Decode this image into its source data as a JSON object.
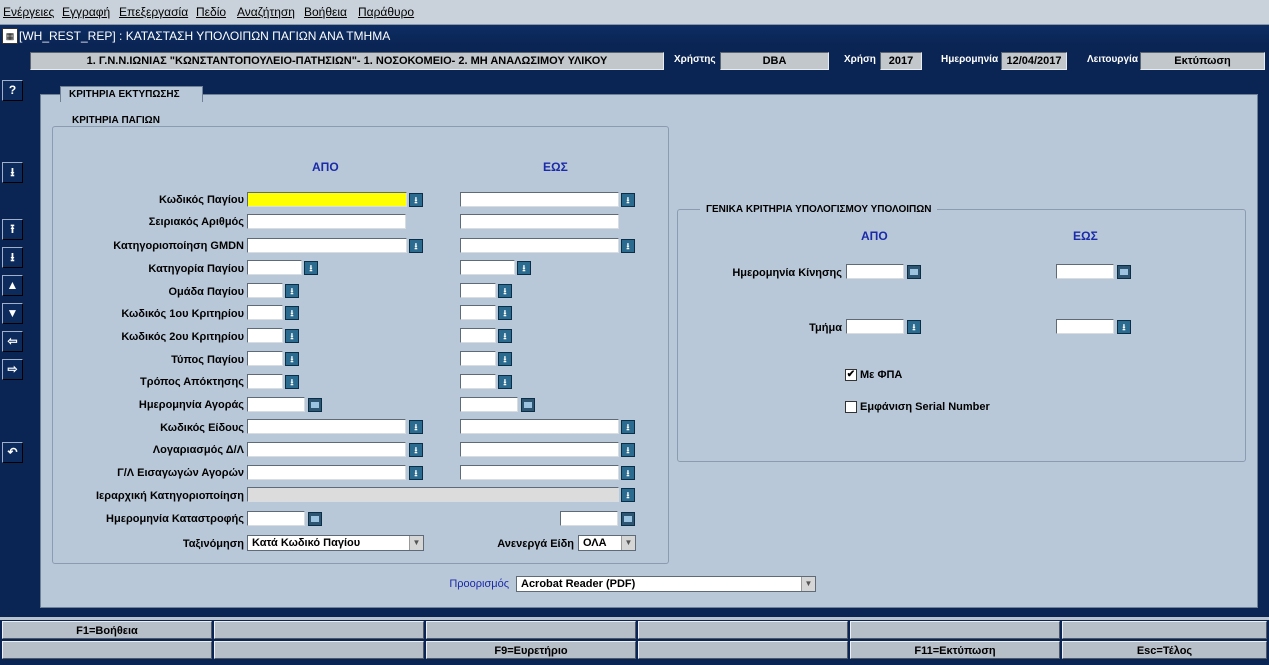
{
  "menu": [
    "Ενέργειες",
    "Εγγραφή",
    "Επεξεργασία",
    "Πεδίο",
    "Αναζήτηση",
    "Βοήθεια",
    "Παράθυρο"
  ],
  "window": {
    "title": "[WH_REST_REP]  :  ΚΑΤΑΣΤΑΣΗ ΥΠΟΛΟΙΠΩΝ ΠΑΓΙΩΝ ΑΝΑ ΤΜΗΜΑ"
  },
  "info": {
    "org": "1. Γ.Ν.Ν.ΙΩΝΙΑΣ \"ΚΩΝΣΤΑΝΤΟΠΟΥΛΕΙΟ-ΠΑΤΗΣΙΩΝ\"- 1. ΝΟΣΟΚΟΜΕΙΟ- 2. ΜΗ ΑΝΑΛΩΣΙΜΟΥ ΥΛΙΚΟΥ",
    "user_label": "Χρήστης",
    "user": "DBA",
    "year_label": "Χρήση",
    "year": "2017",
    "date_label": "Ημερομηνία",
    "date": "12/04/2017",
    "mode_label": "Λειτουργία",
    "mode": "Εκτύπωση"
  },
  "tab_label": "ΚΡΙΤΗΡΙΑ ΕΚΤΥΠΩΣΗΣ",
  "assets": {
    "title": "ΚΡΙΤΗΡΙΑ ΠΑΓΙΩΝ",
    "from": "ΑΠΟ",
    "to": "ΕΩΣ",
    "rows": [
      "Κωδικός Παγίου",
      "Σειριακός Αριθμός",
      "Κατηγοριοποίηση GMDN",
      "Κατηγορία Παγίου",
      "Ομάδα Παγίου",
      "Κωδικός 1ου Κριτηρίου",
      "Κωδικός 2ου Κριτηρίου",
      "Τύπος Παγίου",
      "Τρόπος Απόκτησης",
      "Ημερομηνία Αγοράς",
      "Κωδικός Είδους",
      "Λογαριασμός Δ/Λ",
      "Γ/Λ Εισαγωγών Αγορών",
      "Ιεραρχική Κατηγοριοποίηση",
      "Ημερομηνία Καταστροφής"
    ],
    "sort_label": "Ταξινόμηση",
    "sort_value": "Κατά Κωδικό Παγίου",
    "inactive_label": "Ανενεργά Είδη",
    "inactive_value": "ΟΛΑ"
  },
  "general": {
    "title": "ΓΕΝΙΚΑ ΚΡΙΤΗΡΙΑ ΥΠΟΛΟΓΙΣΜΟΥ ΥΠΟΛΟΙΠΩΝ",
    "from": "ΑΠΟ",
    "to": "ΕΩΣ",
    "move_date_label": "Ημερομηνία Κίνησης",
    "dept_label": "Τμήμα",
    "vat_label": "Με ΦΠΑ",
    "vat_checked": "✔",
    "serial_label": "Εμφάνιση Serial Number"
  },
  "destination": {
    "label": "Προορισμός",
    "value": "Acrobat Reader (PDF)"
  },
  "fkeys": {
    "row1": [
      "F1=Βοήθεια",
      "",
      "",
      "",
      "",
      ""
    ],
    "row2": [
      "",
      "",
      "F9=Ευρετήριο",
      "",
      "F11=Εκτύπωση",
      "Esc=Τέλος"
    ]
  }
}
